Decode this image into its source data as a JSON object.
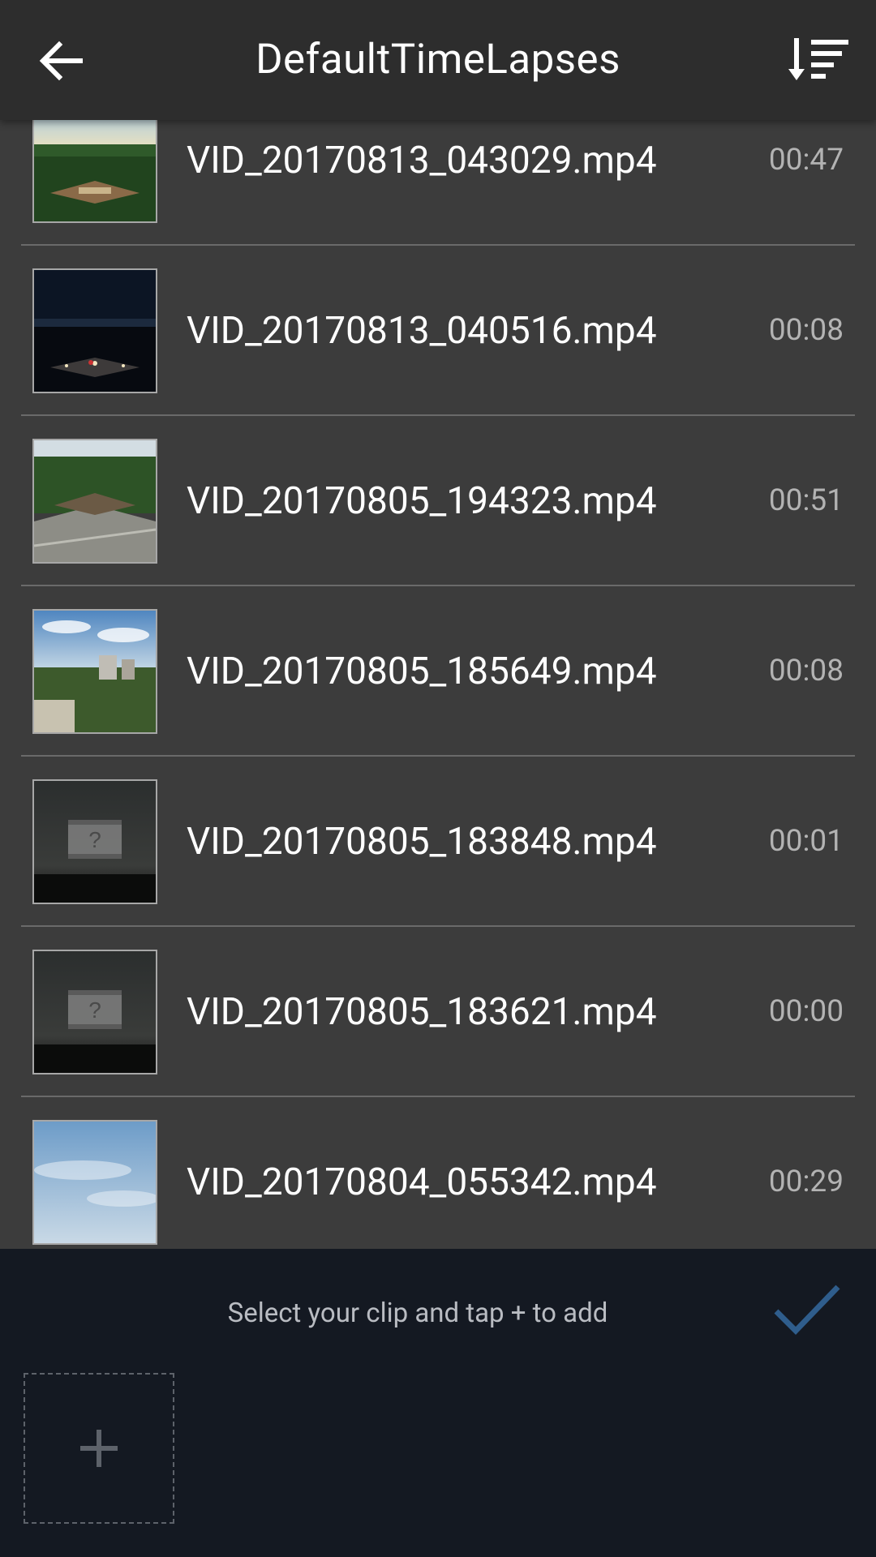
{
  "header": {
    "title": "DefaultTimeLapses",
    "back_icon": "arrow-left-icon",
    "sort_icon": "sort-icon"
  },
  "files": [
    {
      "name": "VID_20170813_043029.mp4",
      "duration": "00:47",
      "thumb": "day-park"
    },
    {
      "name": "VID_20170813_040516.mp4",
      "duration": "00:08",
      "thumb": "night"
    },
    {
      "name": "VID_20170805_194323.mp4",
      "duration": "00:51",
      "thumb": "day-plaza"
    },
    {
      "name": "VID_20170805_185649.mp4",
      "duration": "00:08",
      "thumb": "day-city"
    },
    {
      "name": "VID_20170805_183848.mp4",
      "duration": "00:01",
      "thumb": "unknown"
    },
    {
      "name": "VID_20170805_183621.mp4",
      "duration": "00:00",
      "thumb": "unknown"
    },
    {
      "name": "VID_20170804_055342.mp4",
      "duration": "00:29",
      "thumb": "sky"
    }
  ],
  "bottom": {
    "hint": "Select your clip and tap + to add",
    "confirm_icon": "checkmark-icon",
    "add_icon": "plus-icon"
  },
  "colors": {
    "header_bg": "#2d2d2d",
    "list_bg": "#3c3c3c",
    "bottom_bg": "#141922",
    "accent": "#2f5d8c"
  }
}
